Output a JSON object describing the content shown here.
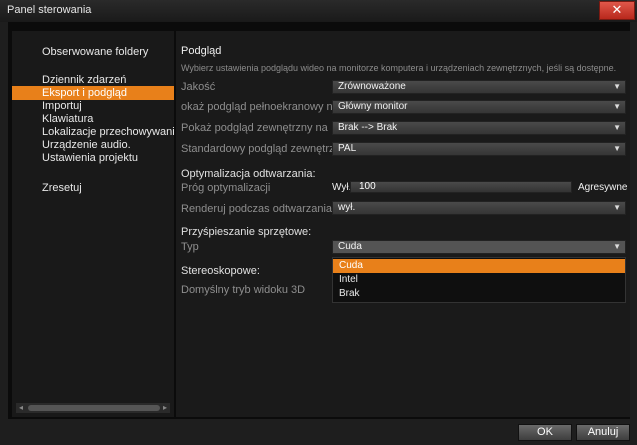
{
  "window": {
    "title": "Panel sterowania",
    "close_symbol": "✕"
  },
  "sidebar": {
    "items": [
      {
        "label": "Obserwowane foldery"
      },
      {
        "label": "Dziennik zdarzeń"
      },
      {
        "label": "Eksport i podgląd",
        "active": true
      },
      {
        "label": "Importuj"
      },
      {
        "label": "Klawiatura"
      },
      {
        "label": "Lokalizacje przechowywania"
      },
      {
        "label": "Urządzenie audio."
      },
      {
        "label": "Ustawienia projektu"
      },
      {
        "label": "Zresetuj"
      }
    ]
  },
  "preview": {
    "heading": "Podgląd",
    "description": "Wybierz ustawienia podglądu wideo na monitorze komputera i urządzeniach zewnętrznych, jeśli są dostępne.",
    "quality": {
      "label": "Jakość",
      "value": "Zrównoważone"
    },
    "fullscreen": {
      "label": "okaż podgląd pełnoekranowy na",
      "value": "Główny monitor"
    },
    "external": {
      "label": "Pokaż podgląd zewnętrzny na",
      "value": "Brak --> Brak"
    },
    "standard": {
      "label": "Standardowy podgląd zewnętrzny",
      "value": "PAL"
    }
  },
  "optimization": {
    "heading": "Optymalizacja odtwarzania:",
    "threshold": {
      "label": "Próg optymalizacji",
      "min_label": "Wył.",
      "value": "100",
      "max_label": "Agresywne"
    },
    "render": {
      "label": "Renderuj podczas odtwarzania",
      "value": "wył."
    }
  },
  "hardware": {
    "heading": "Przyśpieszanie sprzętowe:",
    "type": {
      "label": "Typ",
      "value": "Cuda",
      "options": [
        "Cuda",
        "Intel",
        "Brak"
      ],
      "highlighted": "Cuda"
    }
  },
  "stereo": {
    "heading": "Stereoskopowe:",
    "mode_label": "Domyślny tryb widoku 3D"
  },
  "footer": {
    "ok_label": "OK",
    "cancel_label": "Anuluj"
  },
  "icons": {
    "dropdown": "▼"
  },
  "colors": {
    "accent": "#e8801a",
    "close": "#c8352a"
  }
}
